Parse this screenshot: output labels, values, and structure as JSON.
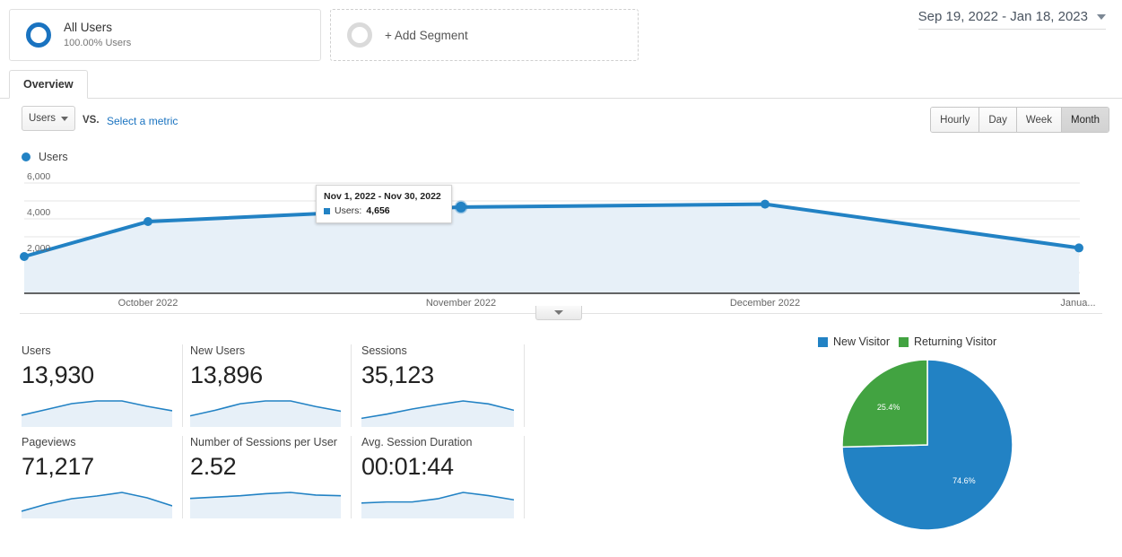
{
  "segment_bar": {
    "all_users": {
      "title": "All Users",
      "subtitle": "100.00% Users",
      "icon": "segment-ring-icon"
    },
    "add_segment": {
      "label": "+ Add Segment",
      "icon": "segment-ring-empty-icon"
    }
  },
  "date_range": {
    "text": "Sep 19, 2022 - Jan 18, 2023",
    "icon": "chevron-down-icon"
  },
  "tabs": [
    {
      "label": "Overview",
      "active": true
    }
  ],
  "metric_controls": {
    "selected_metric": "Users",
    "vs_label": "VS.",
    "select_metric_link": "Select a metric"
  },
  "granularity": {
    "options": [
      "Hourly",
      "Day",
      "Week",
      "Month"
    ],
    "selected": "Month"
  },
  "chart_legend": {
    "label": "Users",
    "color": "#2282c4"
  },
  "tooltip": {
    "title": "Nov 1, 2022 - Nov 30, 2022",
    "metric_label": "Users:",
    "metric_value": "4,656",
    "swatch_color": "#2282c4"
  },
  "chart_data": {
    "type": "line",
    "title": "Users",
    "xlabel": "",
    "ylabel": "Users",
    "ylim": [
      0,
      6000
    ],
    "yticks": [
      "2,000",
      "4,000",
      "6,000"
    ],
    "ytick_values": [
      2000,
      4000,
      6000
    ],
    "grid": true,
    "legend_position": "top-left",
    "x_tick_labels": [
      "October 2022",
      "November 2022",
      "December 2022",
      "Janua..."
    ],
    "categories": [
      "Sep 19 - Sep 30, 2022",
      "Oct 1 - Oct 31, 2022",
      "Nov 1 - Nov 30, 2022",
      "Dec 1 - Dec 31, 2022",
      "Jan 1 - Jan 18, 2023"
    ],
    "series": [
      {
        "name": "Users",
        "color": "#2282c4",
        "values": [
          1900,
          3850,
          4656,
          4820,
          2380
        ]
      }
    ],
    "highlighted_point_index": 2,
    "area_fill": "#e7f0f8"
  },
  "metric_cards": [
    {
      "title": "Users",
      "value": "13,930",
      "spark": [
        20,
        33,
        46,
        52,
        52,
        40,
        30
      ]
    },
    {
      "title": "New Users",
      "value": "13,896",
      "spark": [
        18,
        30,
        44,
        50,
        50,
        38,
        28
      ]
    },
    {
      "title": "Sessions",
      "value": "35,123",
      "spark": [
        14,
        24,
        36,
        46,
        55,
        48,
        33
      ]
    },
    {
      "title": "Pageviews",
      "value": "71,217",
      "spark": [
        10,
        26,
        38,
        44,
        52,
        40,
        22
      ]
    },
    {
      "title": "Number of Sessions per User",
      "value": "2.52",
      "spark": [
        26,
        28,
        30,
        33,
        35,
        31,
        30
      ]
    },
    {
      "title": "Avg. Session Duration",
      "value": "00:01:44",
      "spark": [
        24,
        26,
        26,
        32,
        44,
        38,
        30
      ]
    }
  ],
  "pie_chart": {
    "type": "pie",
    "title": "",
    "legend_position": "top",
    "slices": [
      {
        "label": "New Visitor",
        "value": 74.6,
        "display": "74.6%",
        "color": "#2282c4"
      },
      {
        "label": "Returning Visitor",
        "value": 25.4,
        "display": "25.4%",
        "color": "#42a341"
      }
    ]
  }
}
